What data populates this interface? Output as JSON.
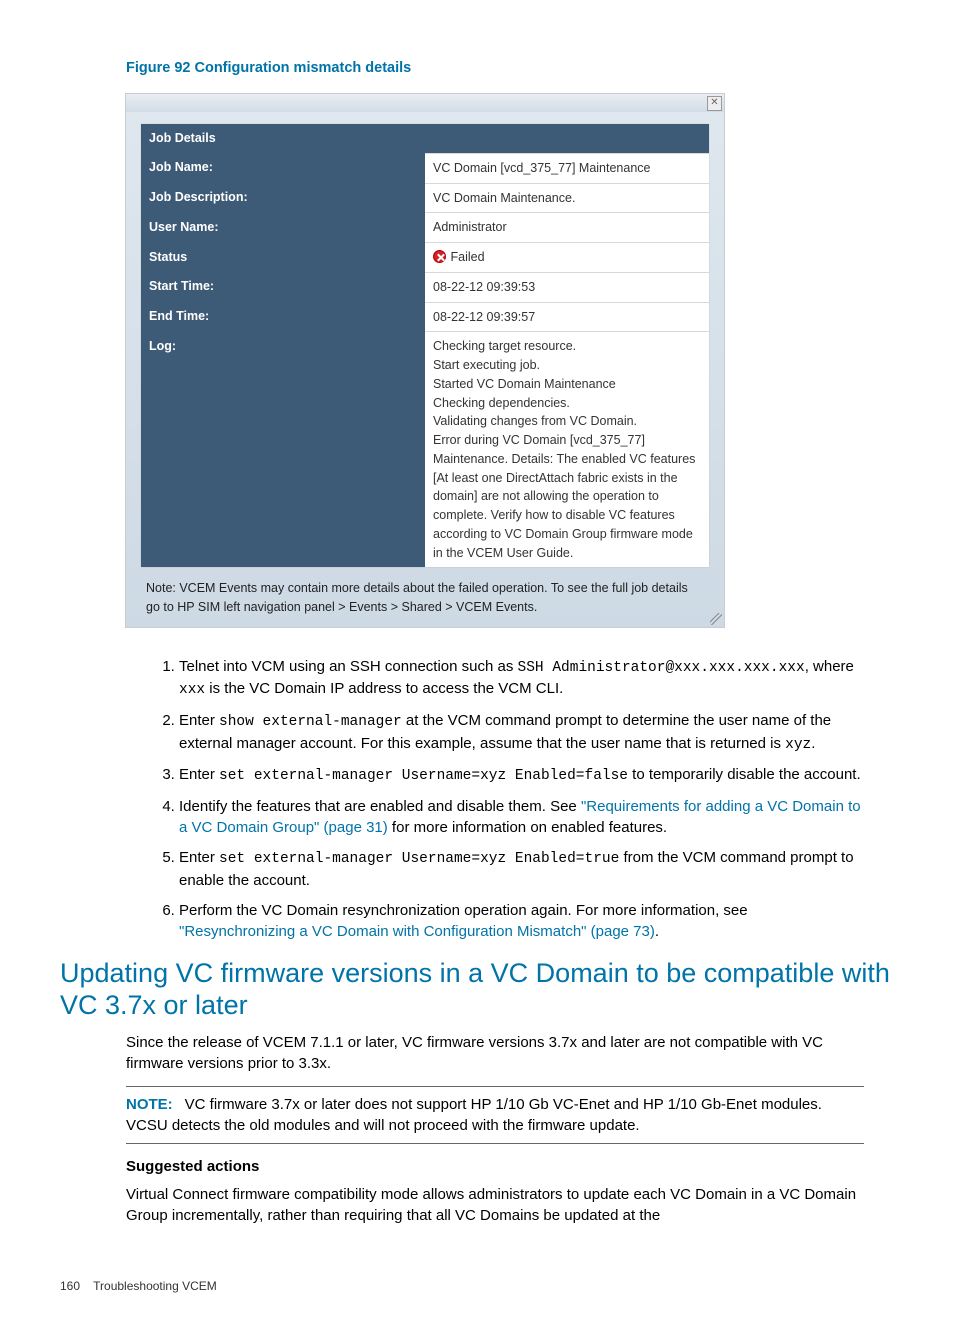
{
  "figure_caption": "Figure 92 Configuration mismatch details",
  "dialog": {
    "header_title": "Job Details",
    "rows": {
      "job_name_label": "Job Name:",
      "job_name_value": "VC Domain [vcd_375_77] Maintenance",
      "job_desc_label": "Job Description:",
      "job_desc_value": "VC Domain Maintenance.",
      "user_label": "User Name:",
      "user_value": "Administrator",
      "status_label": "Status",
      "status_value": "Failed",
      "start_label": "Start Time:",
      "start_value": "08-22-12 09:39:53",
      "end_label": "End Time:",
      "end_value": "08-22-12 09:39:57",
      "log_label": "Log:",
      "log_value": "Checking target resource.\nStart executing job.\nStarted VC Domain Maintenance\nChecking dependencies.\nValidating changes from VC Domain.\nError during VC Domain [vcd_375_77] Maintenance. Details: The enabled VC features [At least one DirectAttach fabric exists in the domain] are not allowing the operation to complete. Verify how to disable VC features according to VC Domain Group firmware mode in the VCEM User Guide."
    },
    "note": "Note: VCEM Events may contain more details about the failed operation. To see the full job details go to HP SIM left navigation panel > Events > Shared > VCEM Events."
  },
  "steps": {
    "s1a": "Telnet into VCM using an SSH connection such as ",
    "s1code": "SSH Administrator@xxx.xxx.xxx.xxx",
    "s1b": ", where ",
    "s1code2": "xxx",
    "s1c": " is the VC Domain IP address to access the VCM CLI.",
    "s2a": "Enter ",
    "s2code": "show external-manager",
    "s2b": " at the VCM command prompt to determine the user name of the external manager account. For this example, assume that the user name that is returned is ",
    "s2code2": "xyz",
    "s2c": ".",
    "s3a": "Enter ",
    "s3code": "set external-manager Username=xyz Enabled=false",
    "s3b": " to temporarily disable the account.",
    "s4a": "Identify the features that are enabled and disable them. See ",
    "s4link": "\"Requirements for adding a VC Domain to a VC Domain Group\" (page 31)",
    "s4b": " for more information on enabled features.",
    "s5a": "Enter ",
    "s5code": "set external-manager Username=xyz Enabled=true",
    "s5b": " from the VCM command prompt to enable the account.",
    "s6a": "Perform the VC Domain resynchronization operation again. For more information, see ",
    "s6link": "\"Resynchronizing a VC Domain with Configuration Mismatch\" (page 73)",
    "s6b": "."
  },
  "section_title": "Updating VC firmware versions in a VC Domain to be compatible with VC 3.7x or later",
  "section_p1": "Since the release of VCEM 7.1.1 or later, VC firmware versions 3.7x and later are not compatible with VC firmware versions prior to 3.3x.",
  "note_label": "NOTE:",
  "note_body": "VC firmware 3.7x or later does not support HP 1/10 Gb VC-Enet and HP 1/10 Gb-Enet modules. VCSU detects the old modules and will not proceed with the firmware update.",
  "suggested_heading": "Suggested actions",
  "suggested_p": "Virtual Connect firmware compatibility mode allows administrators to update each VC Domain in a VC Domain Group incrementally, rather than requiring that all VC Domains be updated at the",
  "footer_page": "160",
  "footer_text": "Troubleshooting VCEM"
}
